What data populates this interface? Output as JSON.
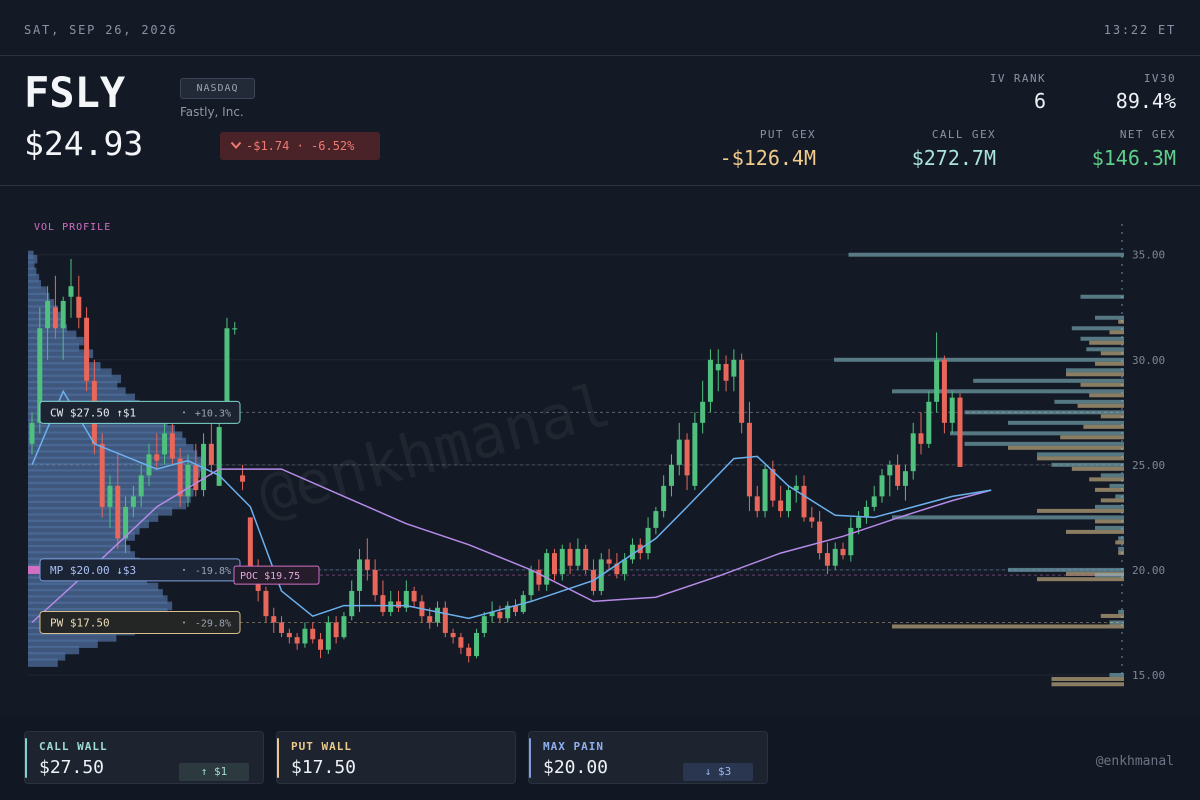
{
  "topbar": {
    "date": "SAT, SEP 26, 2026",
    "time": "13:22 ET"
  },
  "header": {
    "ticker": "FSLY",
    "exchange": "NASDAQ",
    "company": "Fastly, Inc.",
    "price": "$24.93",
    "change": "-$1.74 · -6.52%",
    "iv_rank_label": "IV RANK",
    "iv_rank": "6",
    "iv30_label": "IV30",
    "iv30": "89.4%",
    "put_gex_label": "PUT GEX",
    "put_gex": "-$126.4M",
    "call_gex_label": "CALL GEX",
    "call_gex": "$272.7M",
    "net_gex_label": "NET GEX",
    "net_gex": "$146.3M"
  },
  "colors": {
    "up": "#4fc07e",
    "down": "#e8665a",
    "call": "#7fd4cf",
    "put": "#e9c98f",
    "maxpain": "#7f9fe0",
    "poc": "#d26fc4",
    "ma_fast": "#6cb0ee",
    "ma_slow": "#b68ae8"
  },
  "chart_data": {
    "type": "candlestick",
    "vol_profile_label": "VOL PROFILE",
    "y_ticks": [
      "35.00",
      "30.00",
      "25.00",
      "20.00",
      "15.00"
    ],
    "ylim": [
      14.5,
      36.2
    ],
    "levels": [
      {
        "id": "cw",
        "text": "CW $27.50 ↑$1",
        "pct": "+10.3%",
        "value": 27.5
      },
      {
        "id": "mp",
        "text": "MP $20.00 ↓$3",
        "pct": "-19.8%",
        "value": 20.0
      },
      {
        "id": "pw",
        "text": "PW $17.50",
        "pct": "-29.8%",
        "value": 17.5
      },
      {
        "id": "poc",
        "text": "POC $19.75",
        "value": 19.75
      }
    ],
    "watermark": "@enkhmanal",
    "candles": [
      [
        26.0,
        27.5,
        25.5,
        27.0
      ],
      [
        27.0,
        32.5,
        26.5,
        31.5
      ],
      [
        31.5,
        33.5,
        30.0,
        32.8
      ],
      [
        32.5,
        34.0,
        31.0,
        31.5
      ],
      [
        31.5,
        33.0,
        30.0,
        32.8
      ],
      [
        33.0,
        34.8,
        32.0,
        33.5
      ],
      [
        33.0,
        34.0,
        31.5,
        32.0
      ],
      [
        32.0,
        32.5,
        28.5,
        29.0
      ],
      [
        29.0,
        30.0,
        25.5,
        26.0
      ],
      [
        26.0,
        26.5,
        22.5,
        23.0
      ],
      [
        23.0,
        24.5,
        22.0,
        24.0
      ],
      [
        24.0,
        25.5,
        21.0,
        21.5
      ],
      [
        21.5,
        23.5,
        20.8,
        23.0
      ],
      [
        23.0,
        24.0,
        22.5,
        23.5
      ],
      [
        23.5,
        25.0,
        23.0,
        24.5
      ],
      [
        24.5,
        26.0,
        24.0,
        25.5
      ],
      [
        25.5,
        26.5,
        24.8,
        25.2
      ],
      [
        25.5,
        27.0,
        25.0,
        26.5
      ],
      [
        26.5,
        27.0,
        25.0,
        25.3
      ],
      [
        25.3,
        25.8,
        23.0,
        23.5
      ],
      [
        23.5,
        25.5,
        23.0,
        25.0
      ],
      [
        25.0,
        26.0,
        23.5,
        23.8
      ],
      [
        23.8,
        26.5,
        23.5,
        26.0
      ],
      [
        26.0,
        27.0,
        24.5,
        25.0
      ],
      [
        24.0,
        27.0,
        24.0,
        26.8
      ],
      [
        28.0,
        32.0,
        27.5,
        31.5
      ],
      [
        31.5,
        31.8,
        31.2,
        31.5
      ],
      [
        24.5,
        25.0,
        23.8,
        24.2
      ],
      [
        22.5,
        22.5,
        19.5,
        20.0
      ],
      [
        20.0,
        20.5,
        18.5,
        19.0
      ],
      [
        19.0,
        19.2,
        17.5,
        17.8
      ],
      [
        17.8,
        18.2,
        17.0,
        17.5
      ],
      [
        17.5,
        17.8,
        16.8,
        17.0
      ],
      [
        17.0,
        17.2,
        16.5,
        16.8
      ],
      [
        16.8,
        17.0,
        16.2,
        16.5
      ],
      [
        16.5,
        17.5,
        16.3,
        17.2
      ],
      [
        17.2,
        17.5,
        16.5,
        16.7
      ],
      [
        16.7,
        17.0,
        15.8,
        16.2
      ],
      [
        16.2,
        17.8,
        16.0,
        17.5
      ],
      [
        17.5,
        17.8,
        16.5,
        16.8
      ],
      [
        16.8,
        18.0,
        16.7,
        17.8
      ],
      [
        17.8,
        19.5,
        17.6,
        19.0
      ],
      [
        19.0,
        21.0,
        18.0,
        20.5
      ],
      [
        20.5,
        21.5,
        19.5,
        20.0
      ],
      [
        20.0,
        20.5,
        18.5,
        18.8
      ],
      [
        18.8,
        19.5,
        17.8,
        18.0
      ],
      [
        18.0,
        19.0,
        17.8,
        18.5
      ],
      [
        18.5,
        19.0,
        18.0,
        18.2
      ],
      [
        18.2,
        19.5,
        18.0,
        19.0
      ],
      [
        19.0,
        19.2,
        18.2,
        18.5
      ],
      [
        18.5,
        18.8,
        17.5,
        17.8
      ],
      [
        17.8,
        18.2,
        17.2,
        17.5
      ],
      [
        17.5,
        18.5,
        17.3,
        18.2
      ],
      [
        18.2,
        18.5,
        16.8,
        17.0
      ],
      [
        17.0,
        17.2,
        16.5,
        16.8
      ],
      [
        16.8,
        17.0,
        16.0,
        16.3
      ],
      [
        16.3,
        16.5,
        15.6,
        15.9
      ],
      [
        15.9,
        17.2,
        15.8,
        17.0
      ],
      [
        17.0,
        18.0,
        16.8,
        17.8
      ],
      [
        17.8,
        18.5,
        17.5,
        18.0
      ],
      [
        18.0,
        18.3,
        17.5,
        17.7
      ],
      [
        17.7,
        18.5,
        17.5,
        18.3
      ],
      [
        18.3,
        18.6,
        17.8,
        18.0
      ],
      [
        18.0,
        19.0,
        17.9,
        18.8
      ],
      [
        18.8,
        20.2,
        18.5,
        20.0
      ],
      [
        20.0,
        20.5,
        19.0,
        19.3
      ],
      [
        19.3,
        21.0,
        19.0,
        20.8
      ],
      [
        20.8,
        21.0,
        19.5,
        19.8
      ],
      [
        19.8,
        21.2,
        19.5,
        21.0
      ],
      [
        21.0,
        21.3,
        19.8,
        20.2
      ],
      [
        20.2,
        21.5,
        20.0,
        21.0
      ],
      [
        21.0,
        21.2,
        19.8,
        20.0
      ],
      [
        20.0,
        20.5,
        18.8,
        19.0
      ],
      [
        19.0,
        20.8,
        18.8,
        20.5
      ],
      [
        20.5,
        21.0,
        20.0,
        20.3
      ],
      [
        20.3,
        20.8,
        19.6,
        19.8
      ],
      [
        19.8,
        20.8,
        19.5,
        20.5
      ],
      [
        20.5,
        21.5,
        20.3,
        21.2
      ],
      [
        21.2,
        21.5,
        20.5,
        20.8
      ],
      [
        20.8,
        22.5,
        20.5,
        22.0
      ],
      [
        22.0,
        23.0,
        21.7,
        22.8
      ],
      [
        22.8,
        24.5,
        22.5,
        24.0
      ],
      [
        24.0,
        25.5,
        23.5,
        25.0
      ],
      [
        25.0,
        27.0,
        24.5,
        26.2
      ],
      [
        26.2,
        26.5,
        23.8,
        24.5
      ],
      [
        24.0,
        27.5,
        23.8,
        27.0
      ],
      [
        27.0,
        29.0,
        26.5,
        28.0
      ],
      [
        28.0,
        30.5,
        27.5,
        30.0
      ],
      [
        29.5,
        30.5,
        28.5,
        29.8
      ],
      [
        29.8,
        30.2,
        28.5,
        29.0
      ],
      [
        29.2,
        30.5,
        28.5,
        30.0
      ],
      [
        30.0,
        30.3,
        26.5,
        27.0
      ],
      [
        27.0,
        28.0,
        22.8,
        23.5
      ],
      [
        23.5,
        24.0,
        22.5,
        22.8
      ],
      [
        22.8,
        25.0,
        22.5,
        24.8
      ],
      [
        24.8,
        25.2,
        23.0,
        23.3
      ],
      [
        23.3,
        24.0,
        22.5,
        22.8
      ],
      [
        22.8,
        24.0,
        22.5,
        23.8
      ],
      [
        23.8,
        24.5,
        23.2,
        24.0
      ],
      [
        24.0,
        24.5,
        22.3,
        22.5
      ],
      [
        22.5,
        23.0,
        22.0,
        22.3
      ],
      [
        22.3,
        22.8,
        20.5,
        20.8
      ],
      [
        20.8,
        21.3,
        19.8,
        20.2
      ],
      [
        20.2,
        21.3,
        20.0,
        21.0
      ],
      [
        21.0,
        21.3,
        20.5,
        20.7
      ],
      [
        20.7,
        22.5,
        20.4,
        22.0
      ],
      [
        22.0,
        22.8,
        21.7,
        22.5
      ],
      [
        22.5,
        23.3,
        22.2,
        23.0
      ],
      [
        23.0,
        24.0,
        22.8,
        23.5
      ],
      [
        23.5,
        24.8,
        23.2,
        24.5
      ],
      [
        24.5,
        25.2,
        23.5,
        25.0
      ],
      [
        25.0,
        25.5,
        23.8,
        24.0
      ],
      [
        24.0,
        25.0,
        23.3,
        24.7
      ],
      [
        24.7,
        27.0,
        24.3,
        26.5
      ],
      [
        26.5,
        27.5,
        25.5,
        26.0
      ],
      [
        26.0,
        28.5,
        25.8,
        28.0
      ],
      [
        28.0,
        31.3,
        27.5,
        30.0
      ],
      [
        30.0,
        30.2,
        26.5,
        27.0
      ],
      [
        27.0,
        28.5,
        26.5,
        28.2
      ],
      [
        28.2,
        28.4,
        24.9,
        24.9
      ]
    ],
    "ma_fast": [
      [
        0,
        25.0
      ],
      [
        4,
        28.5
      ],
      [
        8,
        26.0
      ],
      [
        16,
        24.8
      ],
      [
        20,
        25.2
      ],
      [
        24,
        24.5
      ],
      [
        28,
        23.0
      ],
      [
        32,
        19.0
      ],
      [
        36,
        17.8
      ],
      [
        40,
        18.3
      ],
      [
        48,
        18.3
      ],
      [
        56,
        17.7
      ],
      [
        64,
        18.5
      ],
      [
        72,
        19.5
      ],
      [
        80,
        21.5
      ],
      [
        84,
        23.0
      ],
      [
        90,
        25.3
      ],
      [
        93,
        25.4
      ],
      [
        97,
        24.0
      ],
      [
        103,
        22.6
      ],
      [
        108,
        22.5
      ],
      [
        113,
        23.0
      ],
      [
        118,
        23.5
      ],
      [
        123,
        23.8
      ]
    ],
    "ma_slow": [
      [
        0,
        17.5
      ],
      [
        8,
        20.2
      ],
      [
        16,
        23.0
      ],
      [
        24,
        24.8
      ],
      [
        32,
        24.8
      ],
      [
        40,
        23.5
      ],
      [
        48,
        22.2
      ],
      [
        56,
        21.2
      ],
      [
        64,
        20.0
      ],
      [
        72,
        18.5
      ],
      [
        80,
        18.7
      ],
      [
        88,
        19.7
      ],
      [
        96,
        20.8
      ],
      [
        104,
        21.6
      ],
      [
        112,
        22.6
      ],
      [
        118,
        23.3
      ],
      [
        123,
        23.8
      ]
    ],
    "volume_profile": [
      {
        "p": 35.0,
        "v": 0.06
      },
      {
        "p": 34.8,
        "v": 0.1
      },
      {
        "p": 34.5,
        "v": 0.07
      },
      {
        "p": 34.2,
        "v": 0.09
      },
      {
        "p": 33.9,
        "v": 0.12
      },
      {
        "p": 33.6,
        "v": 0.14
      },
      {
        "p": 33.3,
        "v": 0.2
      },
      {
        "p": 33.0,
        "v": 0.23
      },
      {
        "p": 32.7,
        "v": 0.28
      },
      {
        "p": 32.4,
        "v": 0.32
      },
      {
        "p": 32.1,
        "v": 0.35
      },
      {
        "p": 31.8,
        "v": 0.37
      },
      {
        "p": 31.5,
        "v": 0.42
      },
      {
        "p": 31.2,
        "v": 0.52
      },
      {
        "p": 30.9,
        "v": 0.6
      },
      {
        "p": 30.6,
        "v": 0.55
      },
      {
        "p": 30.3,
        "v": 0.7
      },
      {
        "p": 30.0,
        "v": 0.64
      },
      {
        "p": 29.7,
        "v": 0.78
      },
      {
        "p": 29.4,
        "v": 0.9
      },
      {
        "p": 29.1,
        "v": 1.0
      },
      {
        "p": 28.8,
        "v": 0.96
      },
      {
        "p": 28.5,
        "v": 1.05
      },
      {
        "p": 28.2,
        "v": 1.15
      },
      {
        "p": 27.9,
        "v": 1.2
      },
      {
        "p": 27.6,
        "v": 1.25
      },
      {
        "p": 27.3,
        "v": 1.4
      },
      {
        "p": 27.0,
        "v": 1.5
      },
      {
        "p": 26.7,
        "v": 1.58
      },
      {
        "p": 26.4,
        "v": 1.66
      },
      {
        "p": 26.1,
        "v": 1.7
      },
      {
        "p": 25.8,
        "v": 1.78
      },
      {
        "p": 25.5,
        "v": 1.82
      },
      {
        "p": 25.2,
        "v": 1.9
      },
      {
        "p": 24.9,
        "v": 1.88
      },
      {
        "p": 24.6,
        "v": 1.85
      },
      {
        "p": 24.3,
        "v": 1.8
      },
      {
        "p": 24.0,
        "v": 1.75
      },
      {
        "p": 23.7,
        "v": 1.78
      },
      {
        "p": 23.4,
        "v": 1.75
      },
      {
        "p": 23.1,
        "v": 1.7
      },
      {
        "p": 22.8,
        "v": 1.55
      },
      {
        "p": 22.5,
        "v": 1.4
      },
      {
        "p": 22.2,
        "v": 1.3
      },
      {
        "p": 21.9,
        "v": 1.2
      },
      {
        "p": 21.6,
        "v": 1.15
      },
      {
        "p": 21.3,
        "v": 1.05
      },
      {
        "p": 21.0,
        "v": 1.1
      },
      {
        "p": 20.7,
        "v": 1.15
      },
      {
        "p": 20.4,
        "v": 1.2
      },
      {
        "p": 20.1,
        "v": 1.25
      },
      {
        "p": 19.8,
        "v": 1.3
      },
      {
        "p": 19.5,
        "v": 1.28
      },
      {
        "p": 19.2,
        "v": 1.4
      },
      {
        "p": 18.9,
        "v": 1.45
      },
      {
        "p": 18.6,
        "v": 1.5
      },
      {
        "p": 18.3,
        "v": 1.55
      },
      {
        "p": 18.0,
        "v": 1.5
      },
      {
        "p": 17.7,
        "v": 1.45
      },
      {
        "p": 17.4,
        "v": 1.35
      },
      {
        "p": 17.1,
        "v": 1.15
      },
      {
        "p": 16.8,
        "v": 0.95
      },
      {
        "p": 16.5,
        "v": 0.75
      },
      {
        "p": 16.2,
        "v": 0.55
      },
      {
        "p": 15.9,
        "v": 0.4
      },
      {
        "p": 15.6,
        "v": 0.32
      }
    ],
    "gex_profile": [
      {
        "p": 35.0,
        "call": 0.95,
        "put": 0.0
      },
      {
        "p": 33.0,
        "call": 0.15,
        "put": 0.0
      },
      {
        "p": 32.0,
        "call": 0.1,
        "put": 0.02
      },
      {
        "p": 31.5,
        "call": 0.18,
        "put": 0.05
      },
      {
        "p": 31.0,
        "call": 0.15,
        "put": 0.12
      },
      {
        "p": 30.5,
        "call": 0.13,
        "put": 0.08
      },
      {
        "p": 30.0,
        "call": 1.0,
        "put": 0.1
      },
      {
        "p": 29.5,
        "call": 0.2,
        "put": 0.2
      },
      {
        "p": 29.0,
        "call": 0.52,
        "put": 0.15
      },
      {
        "p": 28.5,
        "call": 0.8,
        "put": 0.12
      },
      {
        "p": 28.0,
        "call": 0.24,
        "put": 0.16
      },
      {
        "p": 27.5,
        "call": 0.55,
        "put": 0.08
      },
      {
        "p": 27.0,
        "call": 0.4,
        "put": 0.14
      },
      {
        "p": 26.5,
        "call": 0.6,
        "put": 0.22
      },
      {
        "p": 26.0,
        "call": 0.55,
        "put": 0.4
      },
      {
        "p": 25.5,
        "call": 0.3,
        "put": 0.3
      },
      {
        "p": 25.0,
        "call": 0.25,
        "put": 0.18
      },
      {
        "p": 24.5,
        "call": 0.08,
        "put": 0.12
      },
      {
        "p": 24.0,
        "call": 0.05,
        "put": 0.1
      },
      {
        "p": 23.5,
        "call": 0.03,
        "put": 0.08
      },
      {
        "p": 23.0,
        "call": 0.1,
        "put": 0.3
      },
      {
        "p": 22.5,
        "call": 0.8,
        "put": 0.1
      },
      {
        "p": 22.0,
        "call": 0.1,
        "put": 0.2
      },
      {
        "p": 21.5,
        "call": 0.02,
        "put": 0.03
      },
      {
        "p": 21.0,
        "call": 0.02,
        "put": 0.02
      },
      {
        "p": 20.0,
        "call": 0.4,
        "put": 0.2
      },
      {
        "p": 19.75,
        "call": 0.1,
        "put": 0.3
      },
      {
        "p": 18.0,
        "call": 0.02,
        "put": 0.08
      },
      {
        "p": 17.5,
        "call": 0.05,
        "put": 0.8
      },
      {
        "p": 15.0,
        "call": 0.05,
        "put": 0.25
      },
      {
        "p": 14.75,
        "call": 0.0,
        "put": 0.25
      }
    ]
  },
  "footer": {
    "call_wall": {
      "label": "CALL WALL",
      "value": "$27.50",
      "delta": "↑ $1"
    },
    "put_wall": {
      "label": "PUT WALL",
      "value": "$17.50"
    },
    "max_pain": {
      "label": "MAX PAIN",
      "value": "$20.00",
      "delta": "↓ $3"
    },
    "handle": "@enkhmanal"
  }
}
